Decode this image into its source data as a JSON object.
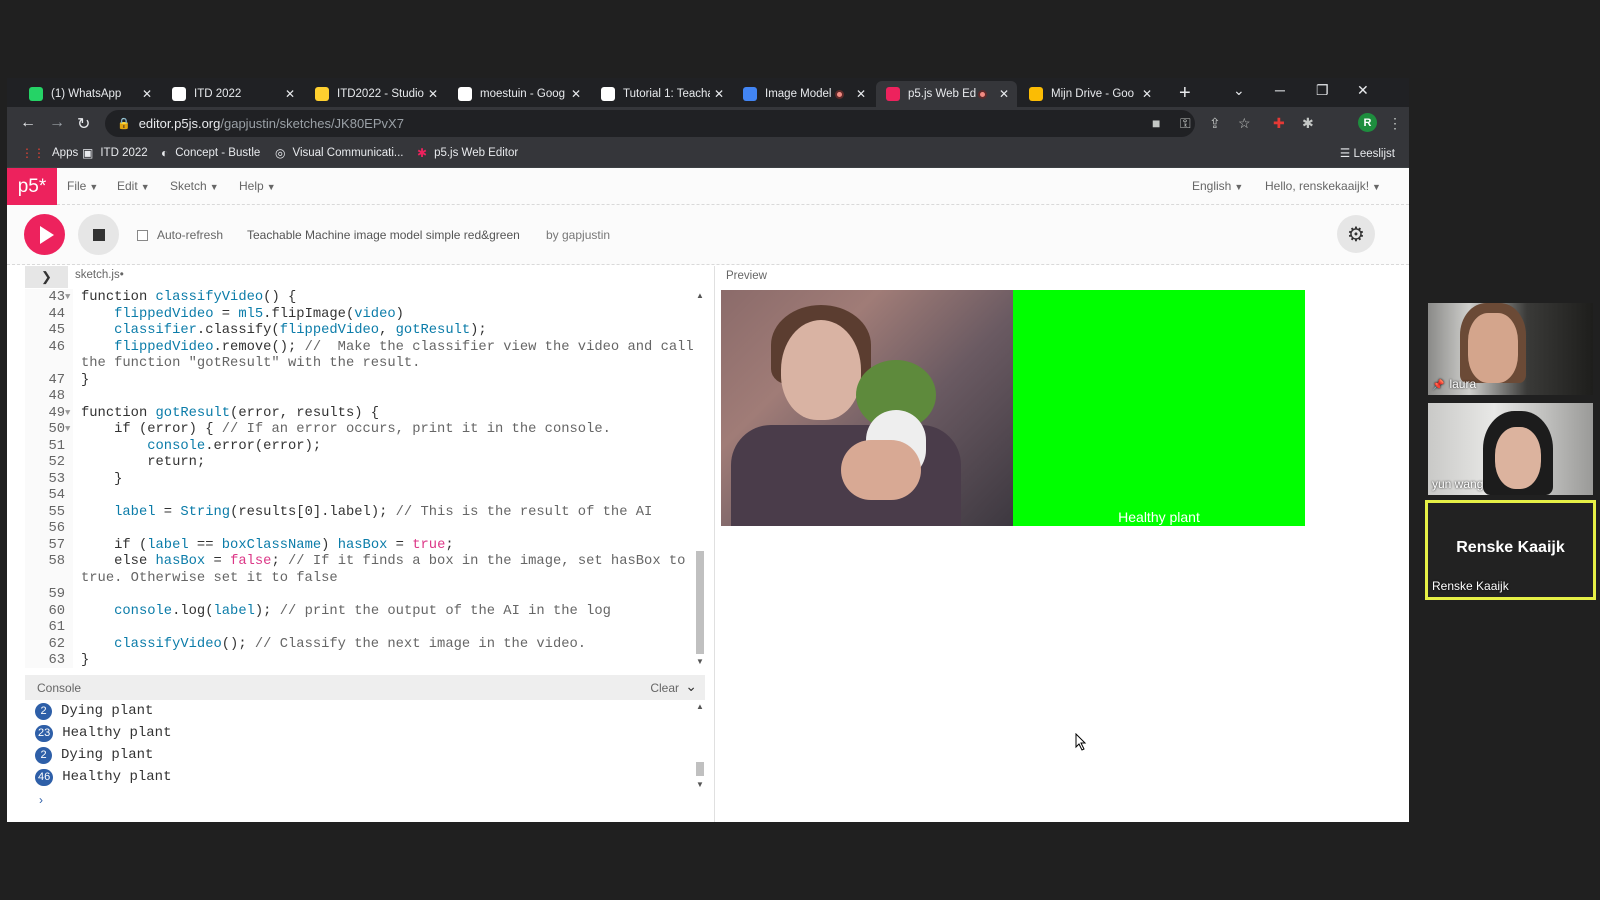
{
  "browser": {
    "tabs": [
      {
        "title": "(1) WhatsApp",
        "icon": "whatsapp-icon",
        "color": "#25d366"
      },
      {
        "title": "ITD 2022",
        "icon": "notion-icon",
        "color": "#ffffff"
      },
      {
        "title": "ITD2022 - Studio",
        "icon": "miro-icon",
        "color": "#ffd02f"
      },
      {
        "title": "moestuin - Goog",
        "icon": "google-icon",
        "color": "#ffffff"
      },
      {
        "title": "Tutorial 1: Teacha",
        "icon": "notion-icon",
        "color": "#ffffff"
      },
      {
        "title": "Image Model",
        "icon": "tm-icon",
        "color": "#4285f4"
      },
      {
        "title": "p5.js Web Ed",
        "icon": "p5-icon",
        "color": "#ed225d"
      },
      {
        "title": "Mijn Drive - Goo",
        "icon": "drive-icon",
        "color": "#fbbc04"
      }
    ],
    "url_host": "editor.p5js.org",
    "url_path": "/gapjustin/sketches/JK80EPvX7",
    "bookmarks": [
      "Apps",
      "ITD 2022",
      "Concept - Bustle",
      "Visual Communicati...",
      "p5.js Web Editor"
    ],
    "reading_list": "Leeslijst",
    "profile_initial": "R"
  },
  "p5": {
    "logo": "p5*",
    "menus": [
      "File",
      "Edit",
      "Sketch",
      "Help"
    ],
    "language": "English",
    "user": "Hello, renskekaaijk!",
    "auto_refresh": "Auto-refresh",
    "sketch_title": "Teachable Machine image model simple red&green",
    "byline": "by gapjustin",
    "filename": "sketch.js",
    "preview_label": "Preview",
    "preview_text": "Healthy plant",
    "console_label": "Console",
    "console_clear": "Clear"
  },
  "code_lines": [
    {
      "n": "43",
      "fold": true,
      "html": "<span class='kw'>function</span> <span class='fn'>classifyVideo</span>() {"
    },
    {
      "n": "44",
      "html": "    <span class='vr'>flippedVideo</span> = <span class='vr'>ml5</span>.flipImage(<span class='vr'>video</span>)"
    },
    {
      "n": "45",
      "html": "    <span class='vr'>classifier</span>.classify(<span class='vr'>flippedVideo</span>, <span class='vr'>gotResult</span>);"
    },
    {
      "n": "46",
      "html": "    <span class='vr'>flippedVideo</span>.remove(); <span class='cm'>//  Make the classifier view the video and call</span>"
    },
    {
      "n": "",
      "html": "<span class='cm'>the function \"gotResult\" with the result.</span>"
    },
    {
      "n": "47",
      "html": "}"
    },
    {
      "n": "48",
      "html": ""
    },
    {
      "n": "49",
      "fold": true,
      "html": "<span class='kw'>function</span> <span class='fn'>gotResult</span>(error, results) {"
    },
    {
      "n": "50",
      "fold": true,
      "html": "    <span class='kw'>if</span> (error) { <span class='cm'>// If an error occurs, print it in the console.</span>"
    },
    {
      "n": "51",
      "html": "        <span class='vr'>console</span>.error(error);"
    },
    {
      "n": "52",
      "html": "        <span class='kw'>return</span>;"
    },
    {
      "n": "53",
      "html": "    }"
    },
    {
      "n": "54",
      "html": ""
    },
    {
      "n": "55",
      "html": "    <span class='vr'>label</span> = <span class='fn'>String</span>(results[0].label); <span class='cm'>// This is the result of the AI</span>"
    },
    {
      "n": "56",
      "html": ""
    },
    {
      "n": "57",
      "html": "    <span class='kw'>if</span> (<span class='vr'>label</span> == <span class='vr'>boxClassName</span>) <span class='vr'>hasBox</span> = <span class='lit'>true</span>;"
    },
    {
      "n": "58",
      "html": "    <span class='kw'>else</span> <span class='vr'>hasBox</span> = <span class='lit'>false</span>; <span class='cm'>// If it finds a box in the image, set hasBox to</span>"
    },
    {
      "n": "",
      "html": "<span class='cm'>true. Otherwise set it to false</span>"
    },
    {
      "n": "59",
      "html": ""
    },
    {
      "n": "60",
      "html": "    <span class='vr'>console</span>.log(<span class='vr'>label</span>); <span class='cm'>// print the output of the AI in the log</span>"
    },
    {
      "n": "61",
      "html": ""
    },
    {
      "n": "62",
      "html": "    <span class='fn'>classifyVideo</span>(); <span class='cm'>// Classify the next image in the video.</span>"
    },
    {
      "n": "63",
      "html": "}"
    }
  ],
  "console_lines": [
    {
      "count": "2",
      "text": "Dying plant"
    },
    {
      "count": "23",
      "text": "Healthy plant"
    },
    {
      "count": "2",
      "text": "Dying plant"
    },
    {
      "count": "46",
      "text": "Healthy plant"
    }
  ],
  "participants": {
    "p1": "laura",
    "p2": "yun wang",
    "p3_big": "Renske Kaaijk",
    "p3_small": "Renske Kaaijk"
  },
  "colors": {
    "p5_accent": "#ed225d",
    "preview_green": "#00ff00",
    "speaker_border": "#e6f046"
  }
}
